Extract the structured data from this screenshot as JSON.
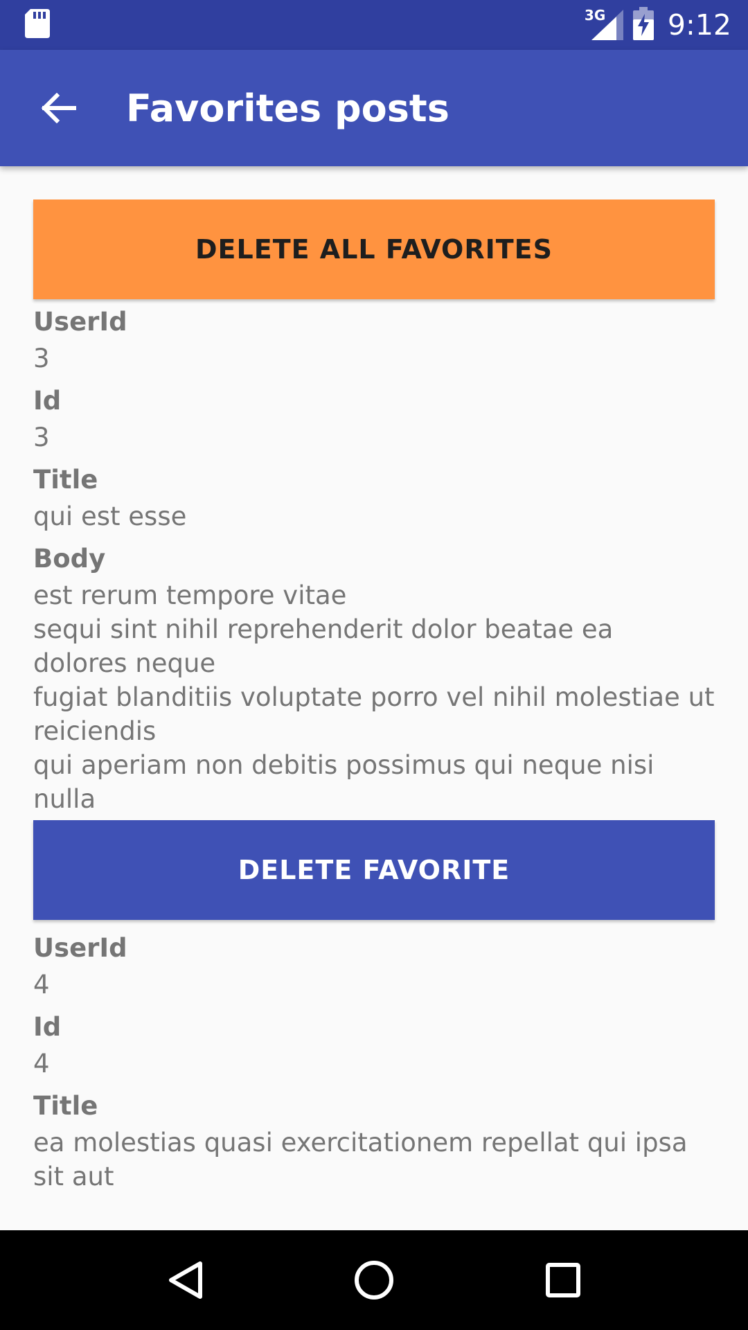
{
  "status_bar": {
    "time": "9:12",
    "network": "3G",
    "icons": [
      "sd-card-icon",
      "signal-3g-icon",
      "battery-charging-icon"
    ]
  },
  "app_bar": {
    "title": "Favorites posts",
    "back_icon": "arrow-back-icon"
  },
  "actions": {
    "delete_all_label": "DELETE ALL FAVORITES"
  },
  "posts": [
    {
      "userId_label": "UserId",
      "userId": "3",
      "id_label": "Id",
      "id": "3",
      "title_label": "Title",
      "title": "qui est esse",
      "body_label": "Body",
      "body": "est rerum tempore vitae\nsequi sint nihil reprehenderit dolor beatae ea dolores neque\nfugiat blanditiis voluptate porro vel nihil molestiae ut reiciendis\nqui aperiam non debitis possimus qui neque nisi nulla",
      "delete_label": "DELETE FAVORITE"
    },
    {
      "userId_label": "UserId",
      "userId": "4",
      "id_label": "Id",
      "id": "4",
      "title_label": "Title",
      "title": "ea molestias quasi exercitationem repellat qui ipsa sit aut"
    }
  ],
  "colors": {
    "status_bar": "#303F9F",
    "app_bar": "#3F51B5",
    "delete_all_button": "#FF9340",
    "delete_button": "#3F51B5",
    "text": "#757575"
  },
  "nav_bar": {
    "icons": [
      "nav-back-icon",
      "nav-home-icon",
      "nav-recents-icon"
    ]
  }
}
